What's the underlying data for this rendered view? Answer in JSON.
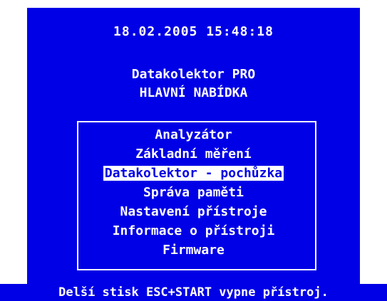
{
  "datetime": "18.02.2005 15:48:18",
  "title": {
    "line1": "Datakolektor PRO",
    "line2": "HLAVNÍ NABÍDKA"
  },
  "menu": {
    "items": [
      {
        "label": "Analyzátor",
        "selected": false
      },
      {
        "label": "Základní měření",
        "selected": false
      },
      {
        "label": "Datakolektor - pochůzka",
        "selected": true
      },
      {
        "label": "Správa paměti",
        "selected": false
      },
      {
        "label": "Nastavení přístroje",
        "selected": false
      },
      {
        "label": "Informace o přístroji",
        "selected": false
      },
      {
        "label": "Firmware",
        "selected": false
      }
    ]
  },
  "status": {
    "text": "Delší stisk ESC+START vypne přístroj."
  },
  "colors": {
    "background": "#0000e6",
    "foreground": "#ffffff"
  }
}
